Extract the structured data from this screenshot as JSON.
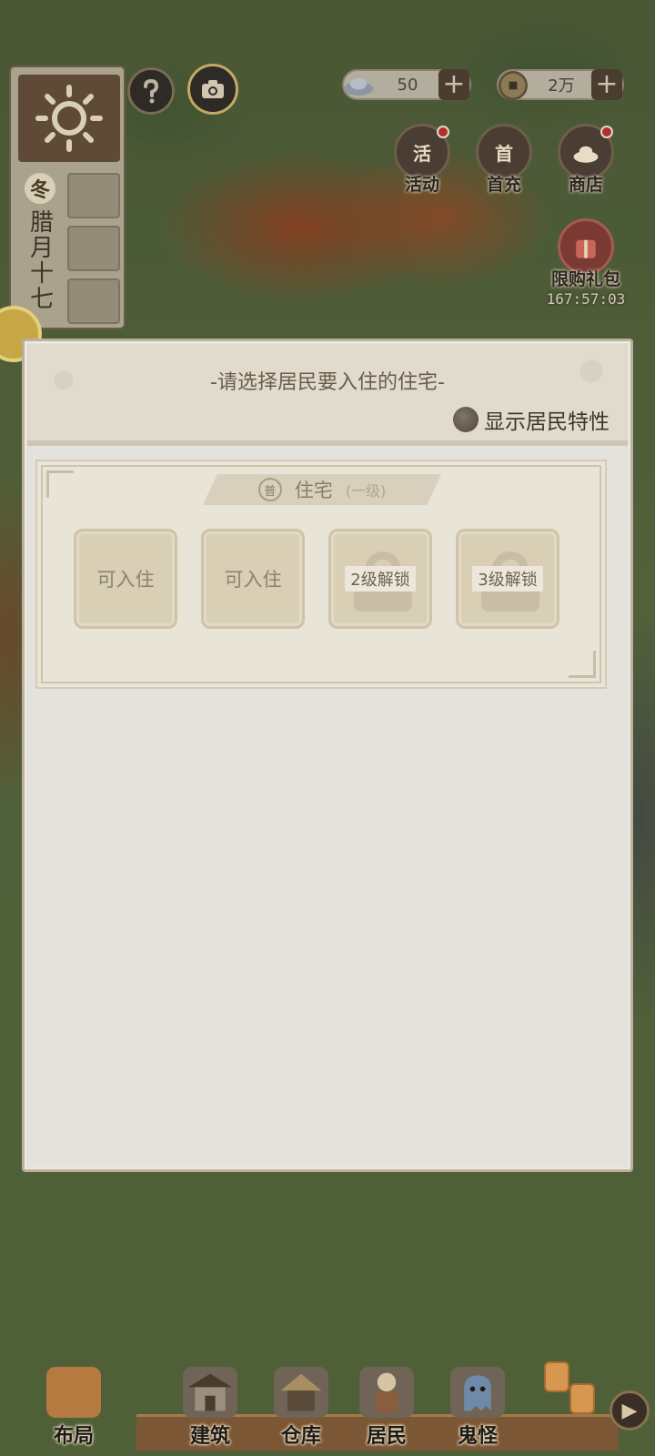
{
  "calendar": {
    "season": "冬",
    "date": "腊月十七",
    "sun_icon": "sun-icon"
  },
  "top_buttons": {
    "help_icon": "question-icon",
    "camera_icon": "camera-icon"
  },
  "currencies": [
    {
      "icon": "silver-ingot-icon",
      "value": "50",
      "plus": "+"
    },
    {
      "icon": "copper-coin-icon",
      "value": "2万",
      "plus": "+"
    }
  ],
  "menu": {
    "activity": {
      "label": "活动",
      "icon_text": "活",
      "has_badge": true
    },
    "first_charge": {
      "label": "首充",
      "icon_text": "首",
      "has_badge": false
    },
    "shop": {
      "label": "商店",
      "has_badge": true
    },
    "limited_gift": {
      "label": "限购礼包",
      "timer": "167:57:03"
    }
  },
  "dialog": {
    "title": "-请选择居民要入住的住宅-",
    "trait_toggle_label": "显示居民特性",
    "house_group": {
      "tier_mark": "普",
      "name": "住宅",
      "level": "(一级)",
      "slots": [
        {
          "label": "可入住",
          "locked": false
        },
        {
          "label": "可入住",
          "locked": false
        },
        {
          "label": "2级解锁",
          "locked": true
        },
        {
          "label": "3级解锁",
          "locked": true
        }
      ]
    }
  },
  "bottom_nav": {
    "layout": "布局",
    "build": "建筑",
    "storage": "仓库",
    "residents": "居民",
    "ghosts": "鬼怪",
    "next_icon": "play-arrow-icon"
  },
  "colors": {
    "dialog_bg": "#e3e2dc",
    "slot_bg": "#d8cfb4",
    "title_text": "#6b5c4a",
    "badge_red": "#b03030"
  }
}
